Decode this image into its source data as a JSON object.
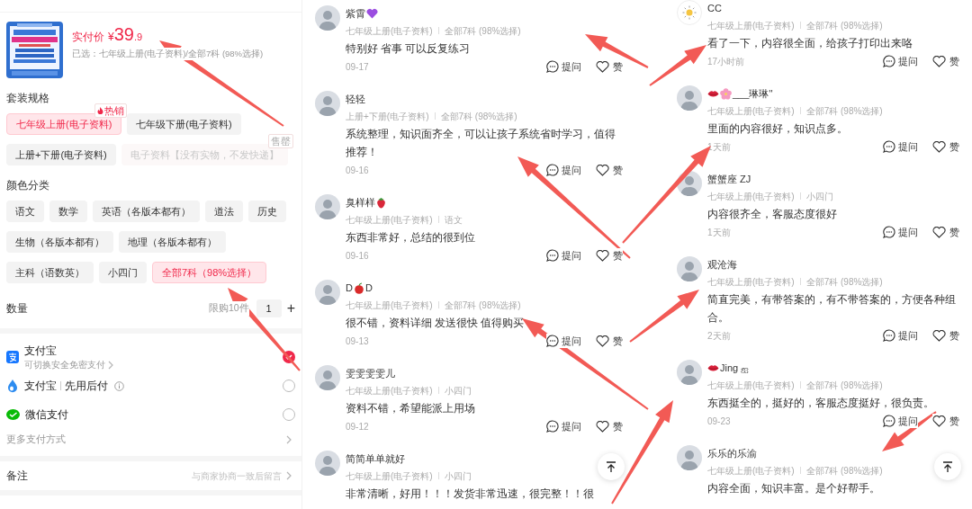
{
  "order_panel": {
    "price": {
      "label": "实付价",
      "currency": "¥",
      "integer": "39",
      "decimal": ".9"
    },
    "selected_summary": "已选：七年级上册(电子资料)/全部7科 (98%选择)",
    "spec_groups": [
      {
        "title": "套装规格",
        "options": [
          {
            "label": "七年级上册(电子资料)",
            "selected": true,
            "disabled": false,
            "badge": {
              "kind": "hot",
              "text": "热销"
            }
          },
          {
            "label": "七年级下册(电子资料)",
            "selected": false,
            "disabled": false
          },
          {
            "label": "上册+下册(电子资料)",
            "selected": false,
            "disabled": false
          },
          {
            "label": "电子资料【没有实物，不发快递】",
            "selected": false,
            "disabled": true,
            "badge": {
              "kind": "soldout",
              "text": "售罄"
            }
          }
        ]
      },
      {
        "title": "颜色分类",
        "options": [
          {
            "label": "语文",
            "selected": false,
            "disabled": false
          },
          {
            "label": "数学",
            "selected": false,
            "disabled": false
          },
          {
            "label": "英语（各版本都有）",
            "selected": false,
            "disabled": false
          },
          {
            "label": "道法",
            "selected": false,
            "disabled": false
          },
          {
            "label": "历史",
            "selected": false,
            "disabled": false
          },
          {
            "label": "生物（各版本都有）",
            "selected": false,
            "disabled": false
          },
          {
            "label": "地理（各版本都有）",
            "selected": false,
            "disabled": false
          },
          {
            "label": "主科（语数英）",
            "selected": false,
            "disabled": false
          },
          {
            "label": "小四门",
            "selected": false,
            "disabled": false
          },
          {
            "label": "全部7科（98%选择）",
            "selected": true,
            "disabled": false
          }
        ]
      }
    ],
    "quantity": {
      "label": "数量",
      "limit": "限购10件",
      "value": "1",
      "increment": "+"
    },
    "payment_methods": [
      {
        "kind": "alipay",
        "label": "支付宝",
        "subtitle": "可切换安全免密支付",
        "selected": true
      },
      {
        "kind": "drop",
        "label": "支付宝",
        "tag": "先用后付",
        "info": true,
        "selected": false
      },
      {
        "kind": "wechat",
        "label": "微信支付",
        "selected": false
      }
    ],
    "more_payment": "更多支付方式",
    "note": {
      "label": "备注",
      "placeholder": "与商家协商一致后留言"
    }
  },
  "review_columns": [
    {
      "reviews": [
        {
          "kind": "photo_avatar",
          "name_parts": [
            {
              "kind": "text",
              "text": "紫霄"
            },
            {
              "kind": "heart"
            }
          ],
          "spec": [
            "七年级上册(电子资料)",
            "全部7科 (98%选择)"
          ],
          "text": "特别好 省事 可以反复练习",
          "time": "09-17",
          "ask": "提问",
          "like": "赞"
        },
        {
          "kind": "photo_avatar",
          "name_parts": [
            {
              "kind": "text",
              "text": "轻轻"
            }
          ],
          "spec": [
            "上册+下册(电子资料)",
            "全部7科 (98%选择)"
          ],
          "text": "系统整理，知识面齐全，可以让孩子系统省时学习，值得推荐！",
          "time": "09-16",
          "ask": "提问",
          "like": "赞"
        },
        {
          "kind": "photo_avatar",
          "name_parts": [
            {
              "kind": "text",
              "text": "臭样样"
            },
            {
              "kind": "strawberry"
            }
          ],
          "spec": [
            "七年级上册(电子资料)",
            "语文"
          ],
          "text": "东西非常好，总结的很到位",
          "time": "09-16",
          "ask": "提问",
          "like": "赞"
        },
        {
          "kind": "photo_avatar",
          "name_parts": [
            {
              "kind": "text",
              "text": "D"
            },
            {
              "kind": "apple"
            },
            {
              "kind": "text",
              "text": "D"
            }
          ],
          "spec": [
            "七年级上册(电子资料)",
            "全部7科 (98%选择)"
          ],
          "text": "很不错，资料详细 发送很快 值得购买",
          "time": "09-13",
          "ask": "提问",
          "like": "赞"
        },
        {
          "kind": "photo_avatar",
          "name_parts": [
            {
              "kind": "text",
              "text": "雯雯雯雯儿"
            }
          ],
          "spec": [
            "七年级上册(电子资料)",
            "小四门"
          ],
          "text": "资料不错，希望能派上用场",
          "time": "09-12",
          "ask": "提问",
          "like": "赞"
        },
        {
          "kind": "photo_avatar",
          "name_parts": [
            {
              "kind": "text",
              "text": "简简单单就好"
            }
          ],
          "spec": [
            "七年级上册(电子资料)",
            "小四门"
          ],
          "text": "非常清晰，好用！！！发货非常迅速，很完整！！很"
        }
      ]
    },
    {
      "reviews": [
        {
          "kind": "sun_avatar",
          "name_parts": [
            {
              "kind": "text",
              "text": "CC"
            }
          ],
          "spec": [
            "七年级上册(电子资料)",
            "全部7科 (98%选择)"
          ],
          "text": "看了一下，内容很全面，给孩子打印出来咯",
          "time": "17小时前",
          "ask": "提问",
          "like": "赞"
        },
        {
          "kind": "photo_avatar",
          "name_parts": [
            {
              "kind": "lips"
            },
            {
              "kind": "flower"
            },
            {
              "kind": "text",
              "text": "___琳琳''"
            }
          ],
          "spec": [
            "七年级上册(电子资料)",
            "全部7科 (98%选择)"
          ],
          "text": "里面的内容很好，知识点多。",
          "time": "1天前",
          "ask": "提问",
          "like": "赞"
        },
        {
          "kind": "photo_avatar",
          "name_parts": [
            {
              "kind": "text",
              "text": "蟹蟹座 ZJ"
            }
          ],
          "spec": [
            "七年级上册(电子资料)",
            "小四门"
          ],
          "text": "内容很齐全，客服态度很好",
          "time": "1天前",
          "ask": "提问",
          "like": "赞"
        },
        {
          "kind": "photo_avatar",
          "name_parts": [
            {
              "kind": "text",
              "text": "观沧海"
            }
          ],
          "spec": [
            "七年级上册(电子资料)",
            "全部7科 (98%选择)"
          ],
          "text": "简直完美，有带答案的，有不带答案的，方便各种组合。",
          "time": "2天前",
          "ask": "提问",
          "like": "赞"
        },
        {
          "kind": "photo_avatar",
          "name_parts": [
            {
              "kind": "lips"
            },
            {
              "kind": "text",
              "text": "Jing ஐ"
            }
          ],
          "spec": [
            "七年级上册(电子资料)",
            "全部7科 (98%选择)"
          ],
          "text": "东西挺全的，挺好的，客服态度挺好，很负责。",
          "time": "09-23",
          "ask": "提问",
          "like": "赞"
        },
        {
          "kind": "photo_avatar",
          "name_parts": [
            {
              "kind": "text",
              "text": "乐乐的乐渝"
            }
          ],
          "spec": [
            "七年级上册(电子资料)",
            "全部7科 (98%选择)"
          ],
          "text": "内容全面，知识丰富。是个好帮手。"
        }
      ]
    }
  ]
}
